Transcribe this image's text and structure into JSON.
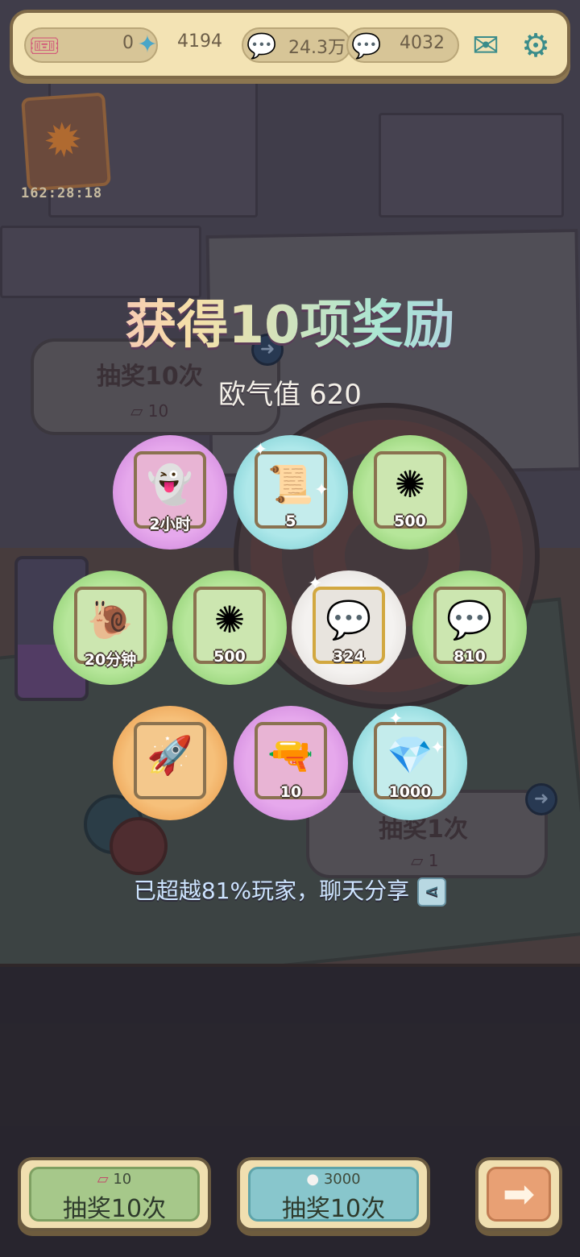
{
  "topbar": {
    "tickets": "0",
    "gems": "4194",
    "soul_dark": "24.3万",
    "soul_light": "4032"
  },
  "event": {
    "timer": "162:28:18"
  },
  "background": {
    "draw10_label": "抽奖10次",
    "draw10_cost": "10",
    "draw1_label": "抽奖1次",
    "draw1_cost": "1"
  },
  "overlay": {
    "title": "获得10项奖励",
    "luck_label": "欧气值 620",
    "share_text": "已超越81%玩家，聊天分享"
  },
  "rewards": [
    {
      "qty": "2小时",
      "icon": "ghost-cloak-icon",
      "rarity": "purple"
    },
    {
      "qty": "5",
      "icon": "scroll-icon",
      "rarity": "cyan"
    },
    {
      "qty": "500",
      "icon": "virus-coin-icon",
      "rarity": "green"
    },
    {
      "qty": "20分钟",
      "icon": "slug-ghost-icon",
      "rarity": "green"
    },
    {
      "qty": "500",
      "icon": "virus-coin-icon",
      "rarity": "green"
    },
    {
      "qty": "324",
      "icon": "soul-bubble-icon",
      "rarity": "white"
    },
    {
      "qty": "810",
      "icon": "soul-bubble-icon",
      "rarity": "green"
    },
    {
      "qty": "",
      "icon": "rocket-stand-icon",
      "rarity": "orange"
    },
    {
      "qty": "10",
      "icon": "cannon-icon",
      "rarity": "purple"
    },
    {
      "qty": "1000",
      "icon": "gem-bag-icon",
      "rarity": "cyan"
    }
  ],
  "buttons": {
    "draw10_ticket_cost": "10",
    "draw10_ticket_label": "抽奖10次",
    "draw10_soul_cost": "3000",
    "draw10_soul_label": "抽奖10次"
  },
  "colors": {
    "purple": "#c67ad6",
    "cyan": "#6cc6cc",
    "green": "#7cc45e",
    "white": "#d8d4d0",
    "orange": "#e68e3a"
  }
}
